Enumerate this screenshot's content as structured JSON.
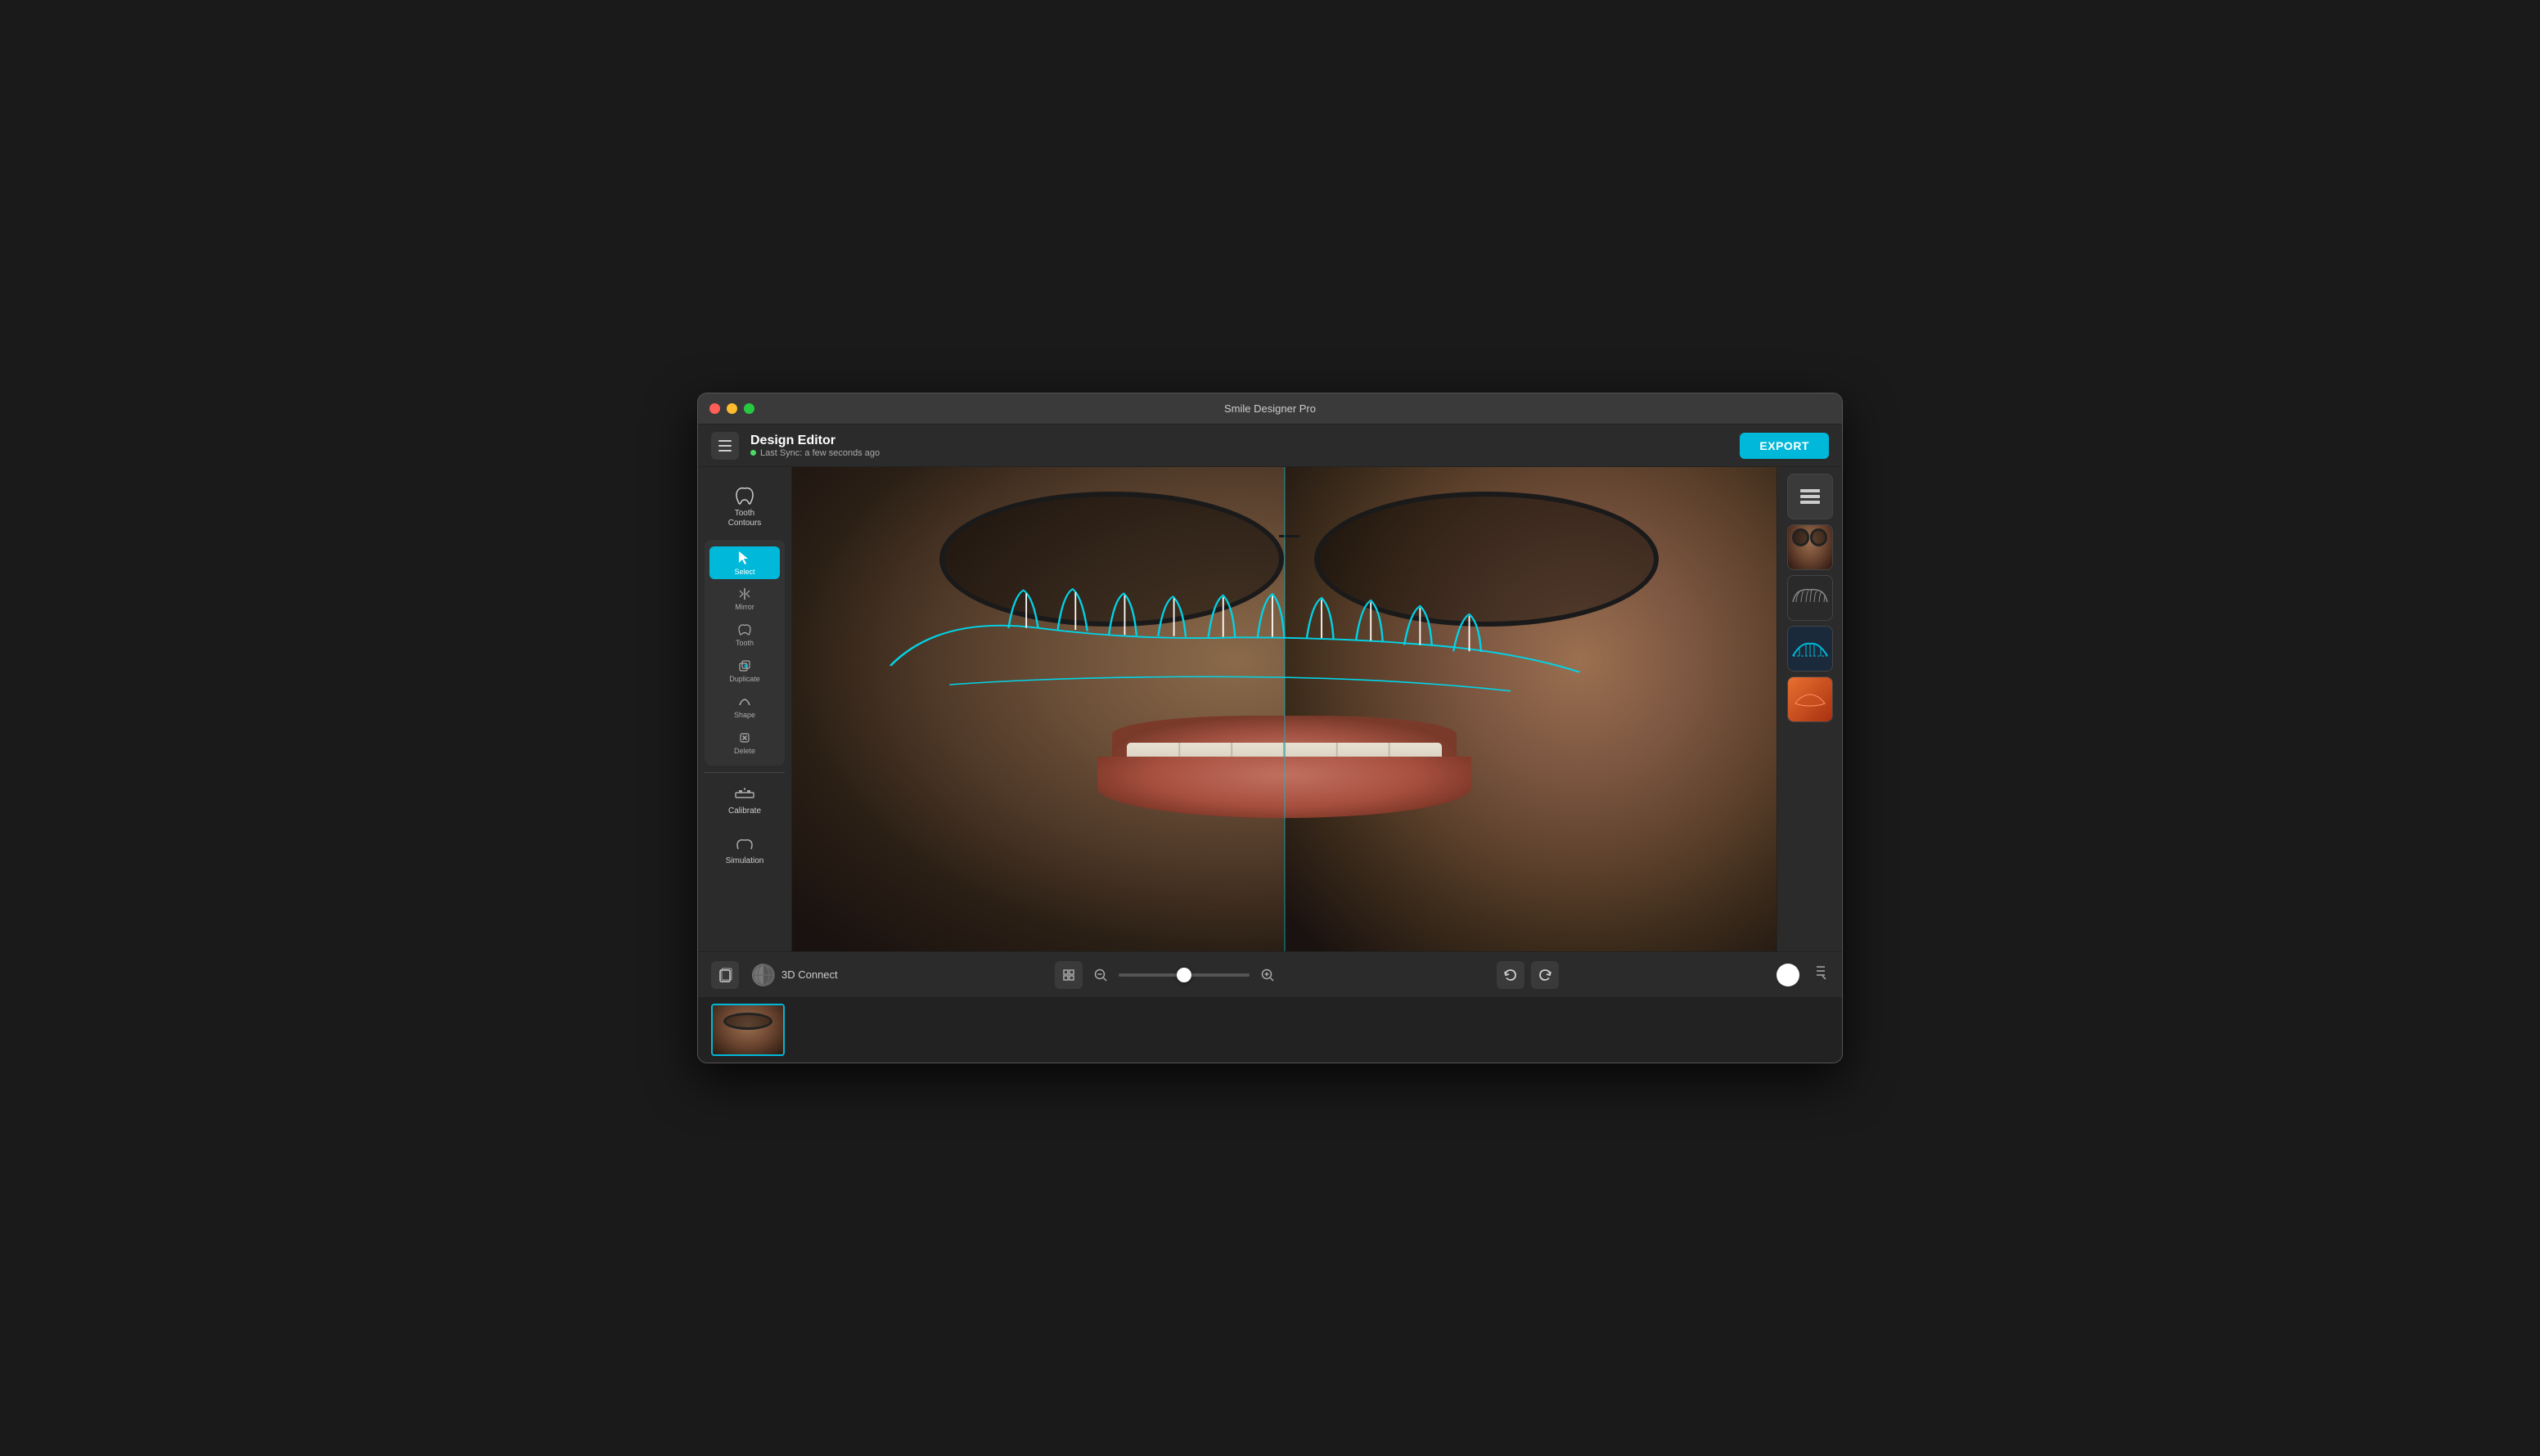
{
  "window": {
    "title": "Smile Designer Pro",
    "traffic_lights": [
      "close",
      "minimize",
      "maximize"
    ]
  },
  "header": {
    "title": "Design Editor",
    "sync_text": "Last Sync: a few seconds ago",
    "export_label": "EXPORT"
  },
  "left_sidebar": {
    "tools": [
      {
        "id": "tooth-contours",
        "label": "Tooth Contours",
        "icon": "🦷"
      },
      {
        "id": "select",
        "label": "Select",
        "active": true
      },
      {
        "id": "tooth",
        "label": "Tooth"
      },
      {
        "id": "shape",
        "label": "Shape"
      },
      {
        "id": "calibrate",
        "label": "Calibrate"
      },
      {
        "id": "simulation",
        "label": "Simulation"
      }
    ],
    "sub_tools": [
      {
        "id": "mirror",
        "label": "Mirror"
      },
      {
        "id": "duplicate",
        "label": "Duplicate"
      },
      {
        "id": "delete",
        "label": "Delete"
      }
    ]
  },
  "bottom_toolbar": {
    "connect_label": "3D Connect",
    "zoom_value": 50,
    "zoom_min": 0,
    "zoom_max": 100
  },
  "right_panel": {
    "panels": [
      "layers",
      "face-photo",
      "teeth-model",
      "curve-model",
      "lip-model"
    ]
  }
}
